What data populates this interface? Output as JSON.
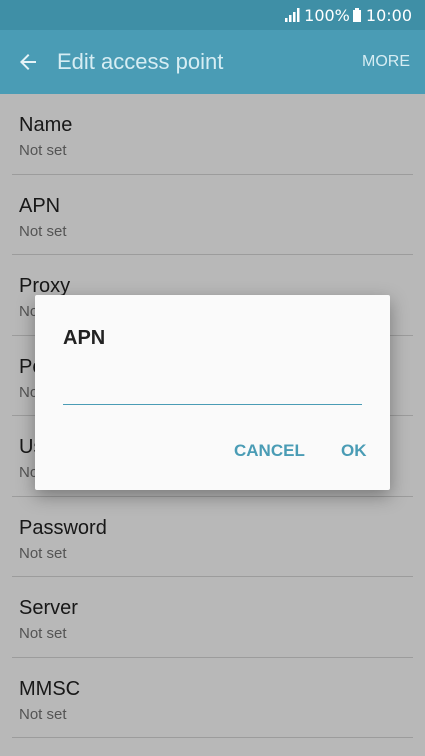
{
  "status_bar": {
    "battery": "100%",
    "time": "10:00",
    "icons": [
      "signal-icon",
      "battery-icon"
    ]
  },
  "app_bar": {
    "title": "Edit access point",
    "more_label": "MORE",
    "back_icon": "back-arrow-icon"
  },
  "list": {
    "items": [
      {
        "title": "Name",
        "value": "Not set"
      },
      {
        "title": "APN",
        "value": "Not set"
      },
      {
        "title": "Proxy",
        "value": "Not set"
      },
      {
        "title": "Port",
        "value": "Not set"
      },
      {
        "title": "Username",
        "value": "Not set"
      },
      {
        "title": "Password",
        "value": "Not set"
      },
      {
        "title": "Server",
        "value": "Not set"
      },
      {
        "title": "MMSC",
        "value": "Not set"
      }
    ]
  },
  "dialog": {
    "title": "APN",
    "input_value": "",
    "cancel_label": "CANCEL",
    "ok_label": "OK"
  },
  "colors": {
    "status_bar": "#3f8fa6",
    "app_bar": "#4a9cb5",
    "accent": "#4a9cb5",
    "dialog_bg": "#fafafa"
  }
}
